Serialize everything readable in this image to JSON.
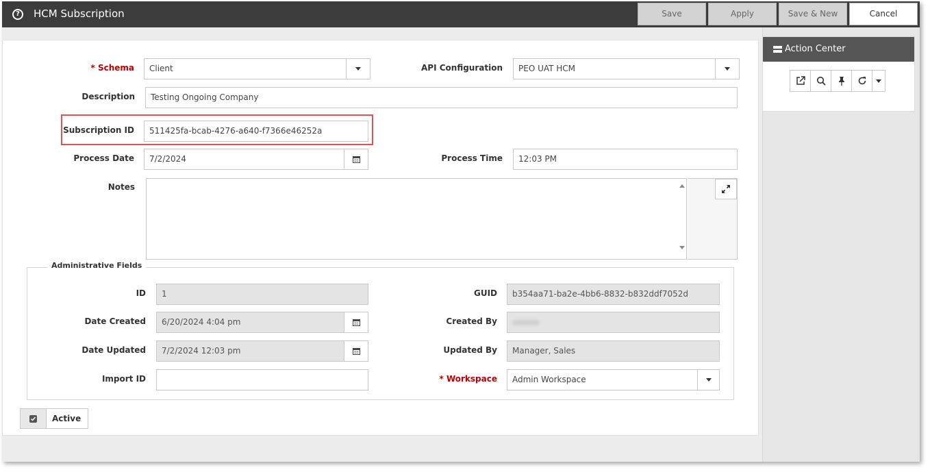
{
  "window": {
    "title": "HCM Subscription",
    "title_icon": "question-circle-icon"
  },
  "toolbar": {
    "save": "Save",
    "apply": "Apply",
    "save_new": "Save & New",
    "cancel": "Cancel"
  },
  "form": {
    "schema": {
      "label": "Schema",
      "required_mark": "*",
      "value": "Client"
    },
    "api_configuration": {
      "label": "API Configuration",
      "value": "PEO UAT HCM"
    },
    "description": {
      "label": "Description",
      "value": "Testing Ongoing Company"
    },
    "subscription_id": {
      "label": "Subscription ID",
      "value": "511425fa-bcab-4276-a640-f7366e46252a"
    },
    "process_date": {
      "label": "Process Date",
      "value": "7/2/2024"
    },
    "process_time": {
      "label": "Process Time",
      "value": "12:03 PM"
    },
    "notes": {
      "label": "Notes",
      "value": ""
    }
  },
  "admin": {
    "legend": "Administrative Fields",
    "id": {
      "label": "ID",
      "value": "1"
    },
    "guid": {
      "label": "GUID",
      "value": "b354aa71-ba2e-4bb6-8832-b832ddf7052d"
    },
    "date_created": {
      "label": "Date Created",
      "value": "6/20/2024 4:04 pm"
    },
    "created_by": {
      "label": "Created By"
    },
    "date_updated": {
      "label": "Date Updated",
      "value": "7/2/2024 12:03 pm"
    },
    "updated_by": {
      "label": "Updated By",
      "value": "Manager, Sales"
    },
    "import_id": {
      "label": "Import ID",
      "value": ""
    },
    "workspace": {
      "label": "Workspace",
      "required_mark": "*",
      "value": "Admin Workspace"
    }
  },
  "active": {
    "label": "Active",
    "checked": true
  },
  "action_center": {
    "title": "Action Center",
    "tools": [
      "external-link-icon",
      "search-icon",
      "pin-icon",
      "refresh-icon",
      "caret-down-icon"
    ]
  },
  "colors": {
    "titlebar": "#3c3c3c",
    "required": "#c00000",
    "highlight": "#e05252",
    "action_center_header": "#555555"
  }
}
